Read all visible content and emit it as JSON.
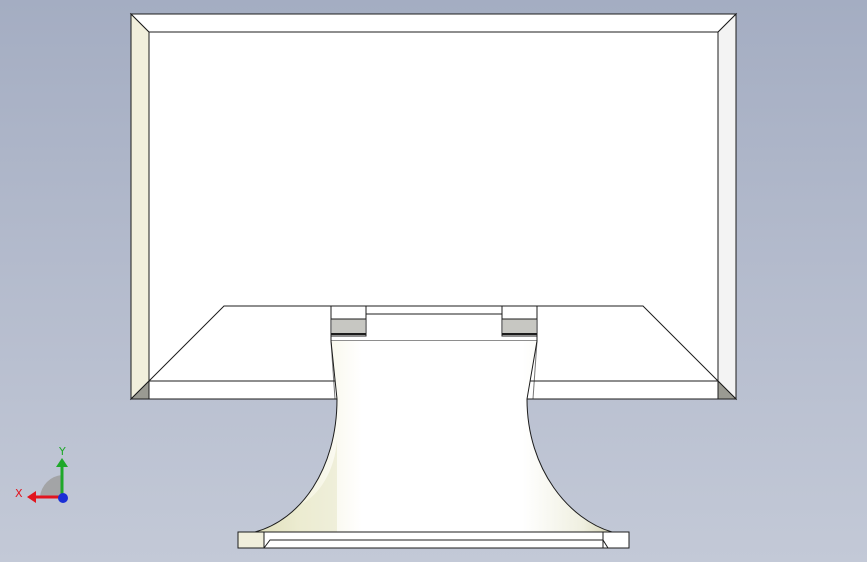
{
  "viewport": {
    "background_top": "#a4adc2",
    "background_bottom": "#c3c9d7",
    "model": "monitor-rear-view"
  },
  "triad": {
    "x_label": "X",
    "y_label": "Y",
    "x_color": "#e2141e",
    "y_color": "#1fa82a",
    "z_color": "#1a2fd6"
  },
  "colors": {
    "face": "#ffffff",
    "bevel_left": "#f1efdc",
    "bevel_right": "#f3f3f3",
    "edge": "#1c1c1c",
    "shadow": "#9a9a92"
  }
}
